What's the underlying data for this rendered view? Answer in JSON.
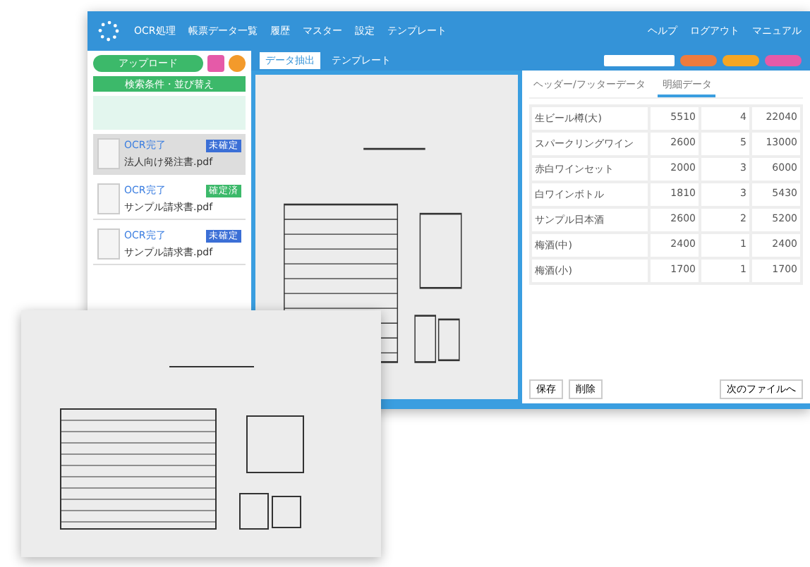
{
  "nav": {
    "items": [
      "OCR処理",
      "帳票データ一覧",
      "履歴",
      "マスター",
      "設定",
      "テンプレート"
    ],
    "right_items": [
      "ヘルプ",
      "ログアウト",
      "マニュアル"
    ]
  },
  "sidebar": {
    "upload": "アップロード",
    "filter_title": "検索条件・並び替え",
    "files": [
      {
        "status": "OCR完了",
        "badge": "未確定",
        "color": "#3b6fd6",
        "name": "法人向け発注書.pdf",
        "selected": true
      },
      {
        "status": "OCR完了",
        "badge": "確定済",
        "color": "#3cb96a",
        "name": "サンプル請求書.pdf",
        "selected": false
      },
      {
        "status": "OCR完了",
        "badge": "未確定",
        "color": "#3b6fd6",
        "name": "サンプル請求書.pdf",
        "selected": false
      }
    ]
  },
  "toolbar": {
    "tabs": [
      {
        "label": "データ抽出",
        "selected": true
      },
      {
        "label": "テンプレート",
        "selected": false
      }
    ]
  },
  "panel": {
    "tabs": [
      {
        "label": "ヘッダー/フッターデータ",
        "selected": false
      },
      {
        "label": "明細データ",
        "selected": true
      }
    ],
    "rows": [
      [
        "生ビール樽(大)",
        "5510",
        "4",
        "22040"
      ],
      [
        "スパークリングワイン",
        "2600",
        "5",
        "13000"
      ],
      [
        "赤白ワインセット",
        "2000",
        "3",
        "6000"
      ],
      [
        "白ワインボトル",
        "1810",
        "3",
        "5430"
      ],
      [
        "サンプル日本酒",
        "2600",
        "2",
        "5200"
      ],
      [
        "梅酒(中)",
        "2400",
        "1",
        "2400"
      ],
      [
        "梅酒(小)",
        "1700",
        "1",
        "1700"
      ]
    ],
    "buttons": [
      "保存",
      "削除"
    ],
    "next": "次のファイルへ"
  }
}
